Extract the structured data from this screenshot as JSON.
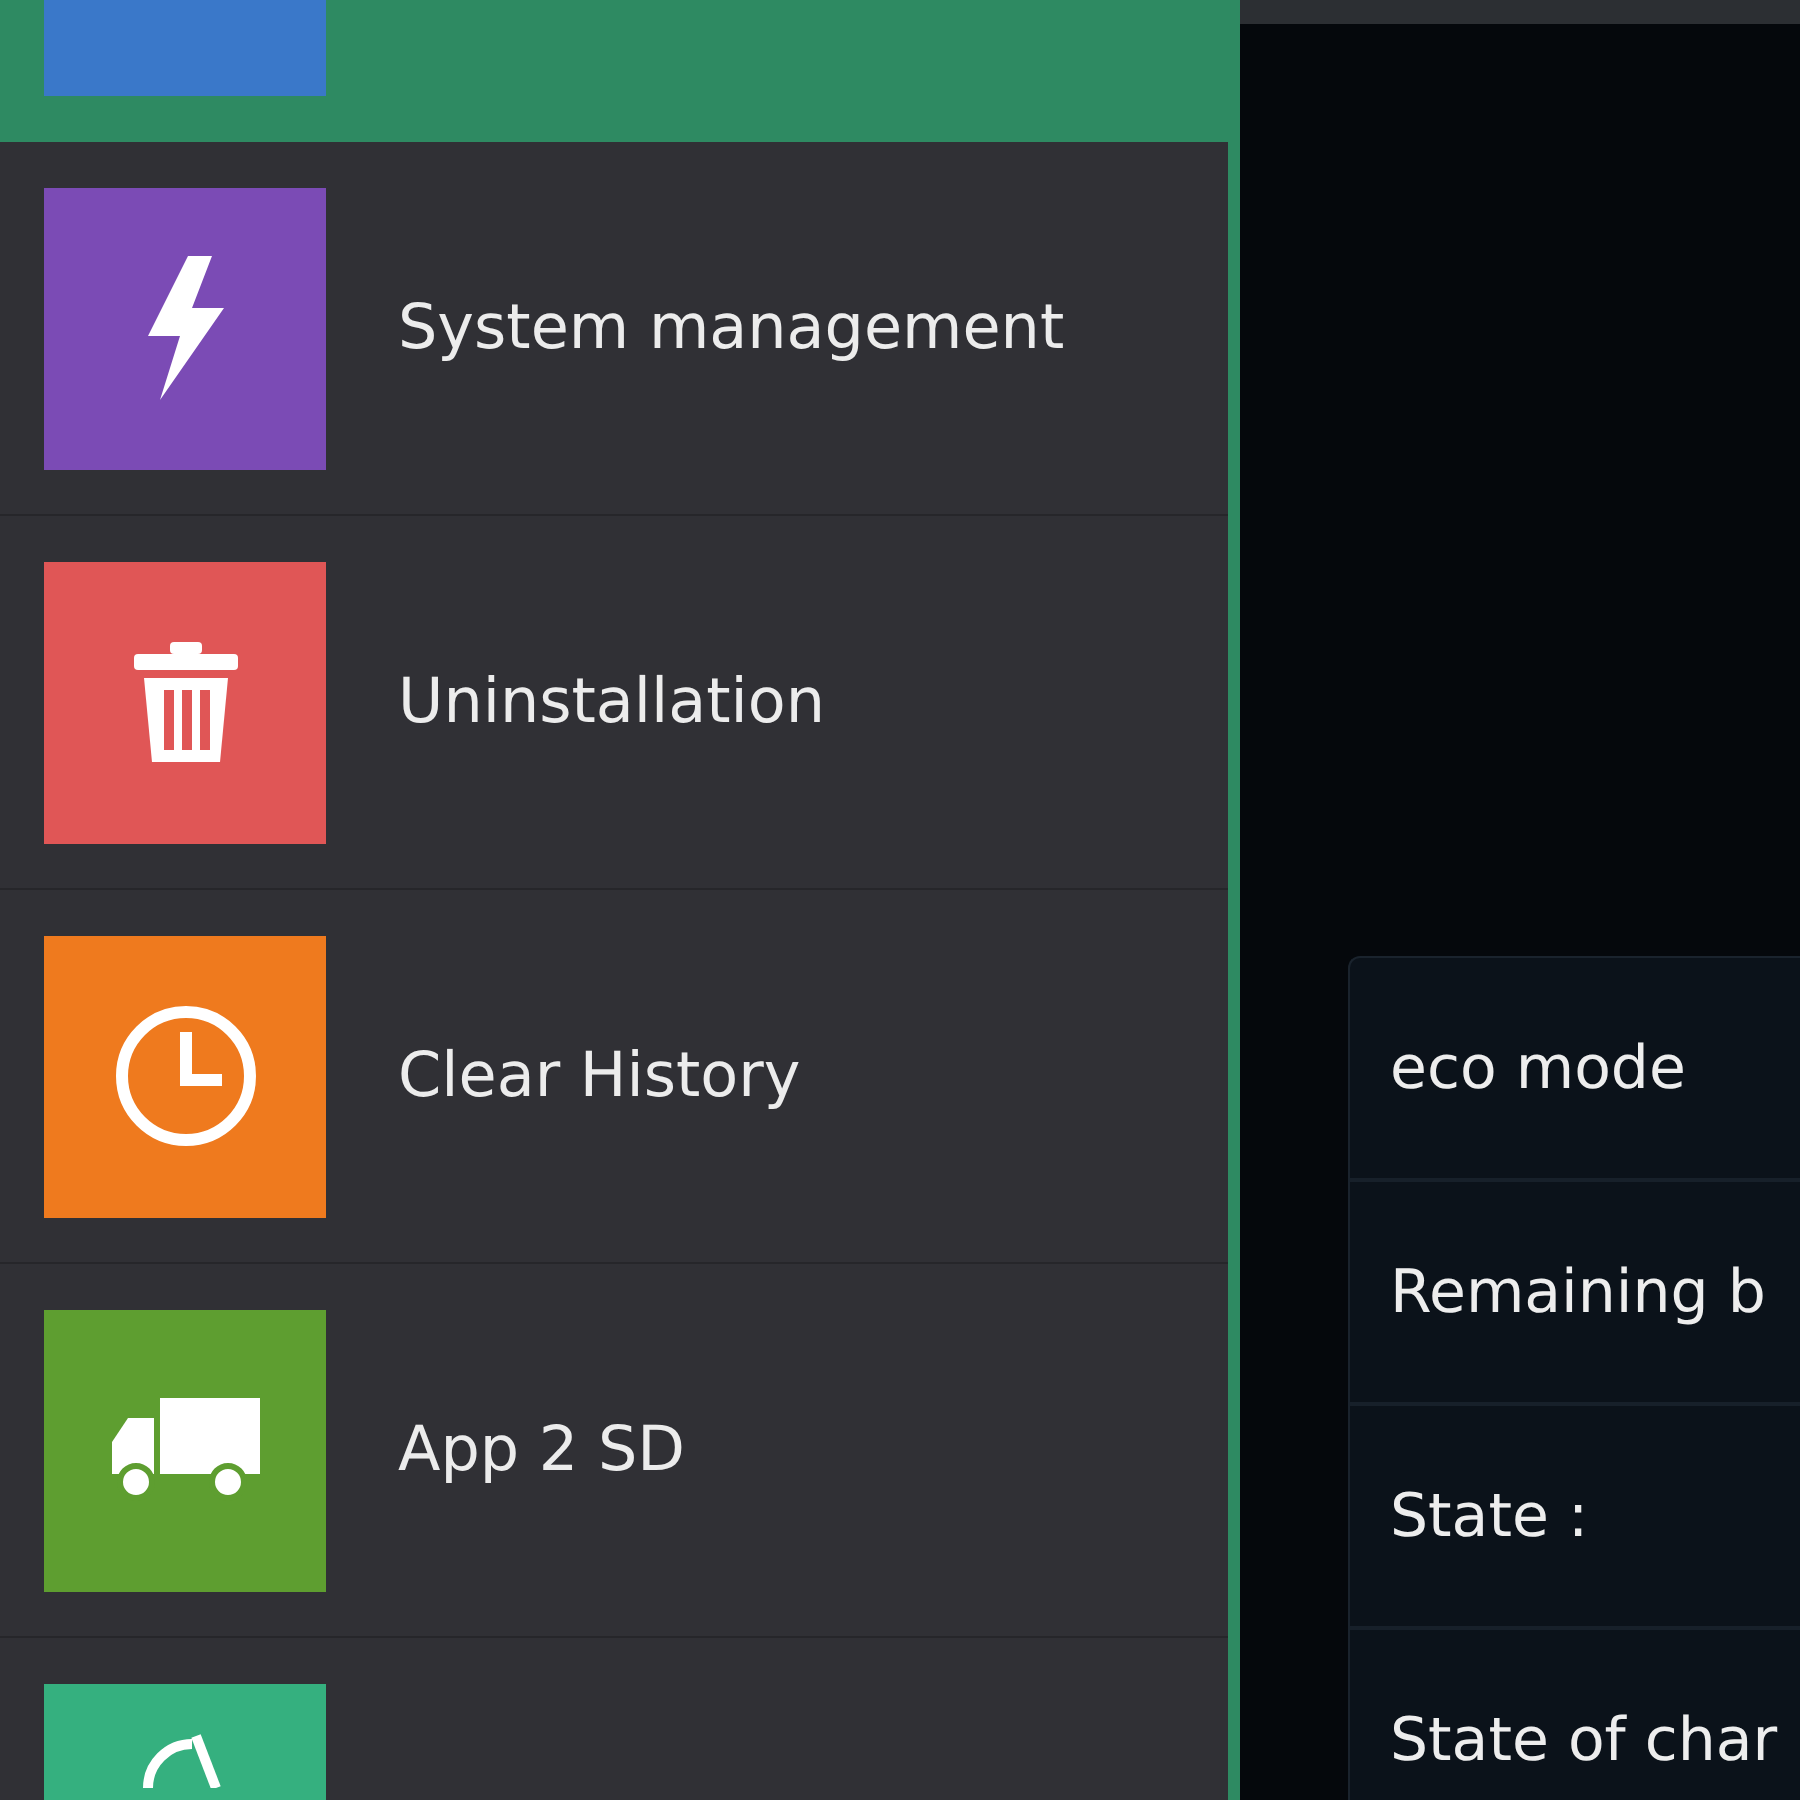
{
  "menu": {
    "items": [
      {
        "kind": "rectangle",
        "color": "#3a78c9",
        "selected": true
      },
      {
        "kind": "bolt",
        "color": "#7b4bb5",
        "selected": false,
        "label": "System management"
      },
      {
        "kind": "trash",
        "color": "#e05656",
        "selected": false,
        "label": "Uninstallation"
      },
      {
        "kind": "clock",
        "color": "#ef7a1e",
        "selected": false,
        "label": "Clear History"
      },
      {
        "kind": "truck",
        "color": "#5e9e30",
        "selected": false,
        "label": "App 2 SD"
      },
      {
        "kind": "arcs",
        "color": "#35b07f",
        "selected": false
      }
    ]
  },
  "info_panel": {
    "rows": [
      {
        "label": "eco mode"
      },
      {
        "label": "Remaining b"
      },
      {
        "label": "State :"
      },
      {
        "label": "State of char"
      }
    ]
  }
}
